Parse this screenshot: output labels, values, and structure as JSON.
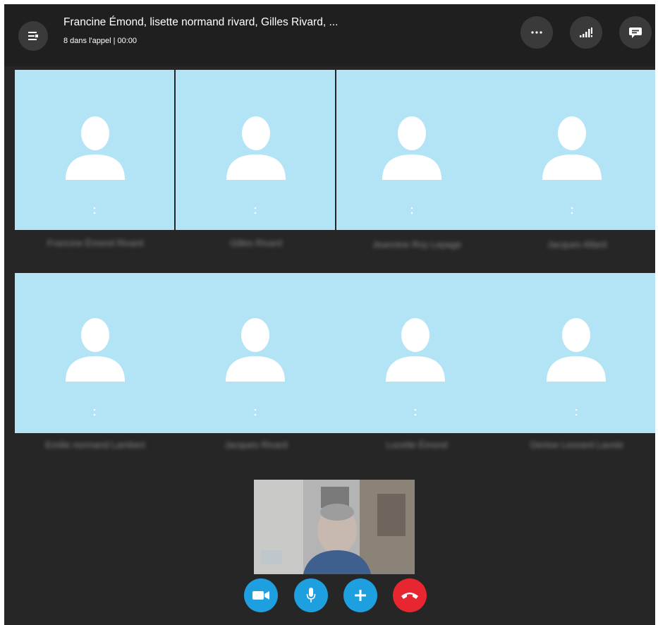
{
  "header": {
    "title": "Francine Émond, lisette normand rivard, Gilles Rivard, ...",
    "subtitle": "8 dans l'appel | 00:00",
    "icons": [
      "menu-icon",
      "more-icon",
      "signal-icon",
      "chat-icon"
    ]
  },
  "participants": [
    {
      "name": "Francine Émond Rivard"
    },
    {
      "name": "Gilles Rivard"
    },
    {
      "name": "Jeannine Roy Lepage"
    },
    {
      "name": "Jacques Allard"
    },
    {
      "name": "Emilie normand Lambert"
    },
    {
      "name": "Jacques Rivard"
    },
    {
      "name": "Lucette Émond"
    },
    {
      "name": "Denise Lessard Lavoie"
    }
  ],
  "controls": {
    "video": {
      "icon": "video-camera-icon",
      "color": "#1e9fe0"
    },
    "mic": {
      "icon": "microphone-icon",
      "color": "#1e9fe0"
    },
    "add": {
      "icon": "plus-icon",
      "color": "#1e9fe0"
    },
    "hangup": {
      "icon": "phone-hangup-icon",
      "color": "#e8262f"
    }
  }
}
